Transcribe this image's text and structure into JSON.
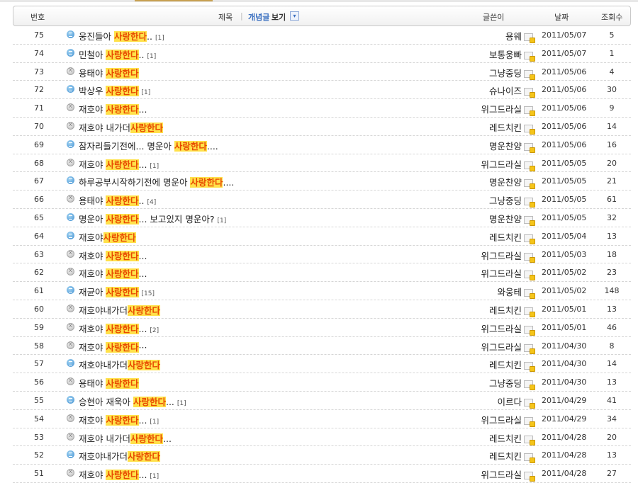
{
  "header": {
    "no": "번호",
    "title": "제목",
    "concept_prefix": "개념글",
    "concept_view": "보기",
    "author": "글쓴이",
    "date": "날짜",
    "views": "조회수"
  },
  "highlight_word": "사랑한다",
  "rows": [
    {
      "no": "75",
      "icon": "blue",
      "pre": "웅진들아 ",
      "hl": "사랑한다",
      "post": "..",
      "count": "[1]",
      "author": "용웨",
      "date": "2011/05/07",
      "views": "5"
    },
    {
      "no": "74",
      "icon": "blue",
      "pre": "민철아 ",
      "hl": "사랑한다",
      "post": "..",
      "count": "[1]",
      "author": "보통웅빠",
      "date": "2011/05/07",
      "views": "1"
    },
    {
      "no": "73",
      "icon": "gray",
      "pre": "용태야 ",
      "hl": "사랑한다",
      "post": "",
      "count": "",
      "author": "그냥중딩",
      "date": "2011/05/06",
      "views": "4"
    },
    {
      "no": "72",
      "icon": "blue",
      "pre": "박상우 ",
      "hl": "사랑한다",
      "post": "",
      "count": "[1]",
      "author": "슈나이즈",
      "date": "2011/05/06",
      "views": "30"
    },
    {
      "no": "71",
      "icon": "gray",
      "pre": "재호야 ",
      "hl": "사랑한다",
      "post": "...",
      "count": "",
      "author": "위그드라실",
      "date": "2011/05/06",
      "views": "9"
    },
    {
      "no": "70",
      "icon": "gray",
      "pre": "재호야 내가더",
      "hl": "사랑한다",
      "post": "",
      "count": "",
      "author": "레드치킨",
      "date": "2011/05/06",
      "views": "14"
    },
    {
      "no": "69",
      "icon": "blue",
      "pre": "잠자리들기전에... 명운아 ",
      "hl": "사랑한다",
      "post": "....",
      "count": "",
      "author": "명운찬양",
      "date": "2011/05/06",
      "views": "16"
    },
    {
      "no": "68",
      "icon": "gray",
      "pre": "재호야 ",
      "hl": "사랑한다",
      "post": "...",
      "count": "[1]",
      "author": "위그드라실",
      "date": "2011/05/05",
      "views": "20"
    },
    {
      "no": "67",
      "icon": "blue",
      "pre": "하루공부시작하기전에 명운아 ",
      "hl": "사랑한다",
      "post": "....",
      "count": "",
      "author": "명운찬양",
      "date": "2011/05/05",
      "views": "21"
    },
    {
      "no": "66",
      "icon": "gray",
      "pre": "용태야 ",
      "hl": "사랑한다",
      "post": "..",
      "count": "[4]",
      "author": "그냥중딩",
      "date": "2011/05/05",
      "views": "61"
    },
    {
      "no": "65",
      "icon": "blue",
      "pre": "명운아 ",
      "hl": "사랑한다",
      "post": "... 보고있지 명운아?",
      "count": "[1]",
      "author": "명운찬양",
      "date": "2011/05/05",
      "views": "32"
    },
    {
      "no": "64",
      "icon": "blue",
      "pre": "재호야",
      "hl": "사랑한다",
      "post": "",
      "count": "",
      "author": "레드치킨",
      "date": "2011/05/04",
      "views": "13"
    },
    {
      "no": "63",
      "icon": "gray",
      "pre": "재호야 ",
      "hl": "사랑한다",
      "post": "...",
      "count": "",
      "author": "위그드라실",
      "date": "2011/05/03",
      "views": "18"
    },
    {
      "no": "62",
      "icon": "gray",
      "pre": "재호야 ",
      "hl": "사랑한다",
      "post": "...",
      "count": "",
      "author": "위그드라실",
      "date": "2011/05/02",
      "views": "23"
    },
    {
      "no": "61",
      "icon": "blue",
      "pre": "재균아 ",
      "hl": "사랑한다",
      "post": "",
      "count": "[15]",
      "author": "와웅테",
      "date": "2011/05/02",
      "views": "148"
    },
    {
      "no": "60",
      "icon": "gray",
      "pre": "재호야내가더",
      "hl": "사랑한다",
      "post": "",
      "count": "",
      "author": "레드치킨",
      "date": "2011/05/01",
      "views": "13"
    },
    {
      "no": "59",
      "icon": "gray",
      "pre": "재호야 ",
      "hl": "사랑한다",
      "post": "...",
      "count": "[2]",
      "author": "위그드라실",
      "date": "2011/05/01",
      "views": "46"
    },
    {
      "no": "58",
      "icon": "gray",
      "pre": "재호야 ",
      "hl": "사랑한다",
      "post": "···",
      "count": "",
      "author": "위그드라실",
      "date": "2011/04/30",
      "views": "8"
    },
    {
      "no": "57",
      "icon": "blue",
      "pre": "재호야내가더",
      "hl": "사랑한다",
      "post": "",
      "count": "",
      "author": "레드치킨",
      "date": "2011/04/30",
      "views": "14"
    },
    {
      "no": "56",
      "icon": "gray",
      "pre": "용태야 ",
      "hl": "사랑한다",
      "post": "",
      "count": "",
      "author": "그냥중딩",
      "date": "2011/04/30",
      "views": "13"
    },
    {
      "no": "55",
      "icon": "blue",
      "pre": "승현아 재욱아 ",
      "hl": "사랑한다",
      "post": "...",
      "count": "[1]",
      "author": "이르다",
      "date": "2011/04/29",
      "views": "41"
    },
    {
      "no": "54",
      "icon": "gray",
      "pre": "재호야 ",
      "hl": "사랑한다",
      "post": "...",
      "count": "[1]",
      "author": "위그드라실",
      "date": "2011/04/29",
      "views": "34"
    },
    {
      "no": "53",
      "icon": "gray",
      "pre": "재호야 내가더",
      "hl": "사랑한다",
      "post": "...",
      "count": "",
      "author": "레드치킨",
      "date": "2011/04/28",
      "views": "20"
    },
    {
      "no": "52",
      "icon": "blue",
      "pre": "재호야내가더",
      "hl": "사랑한다",
      "post": "",
      "count": "",
      "author": "레드치킨",
      "date": "2011/04/28",
      "views": "13"
    },
    {
      "no": "51",
      "icon": "gray",
      "pre": "재호야 ",
      "hl": "사랑한다",
      "post": "...",
      "count": "[1]",
      "author": "위그드라실",
      "date": "2011/04/28",
      "views": "27"
    }
  ]
}
